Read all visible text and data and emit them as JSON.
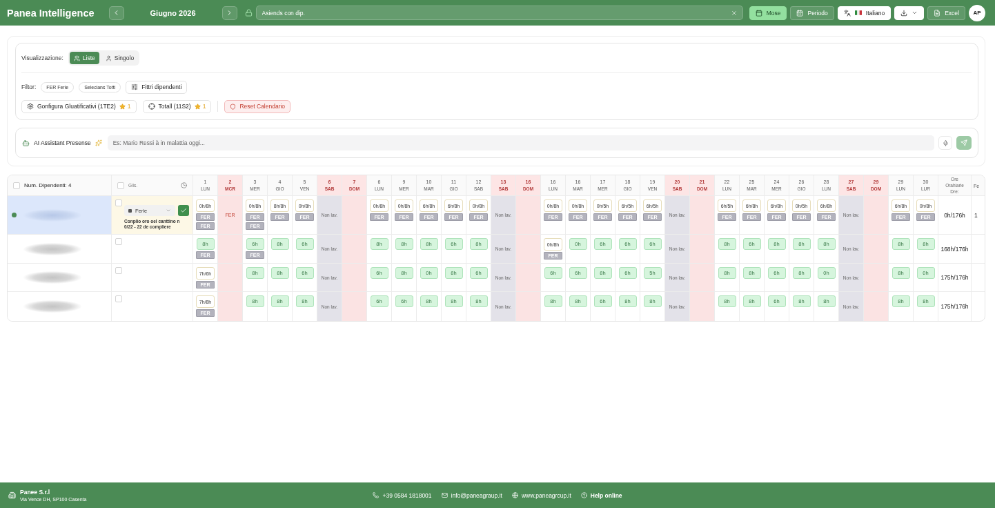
{
  "topbar": {
    "title": "Panea Intelligence",
    "month": "Giugno 2026",
    "search": {
      "value": "Asiends con dip."
    },
    "view_buttons": [
      {
        "label": "Mose",
        "selected": true
      },
      {
        "label": "Periodo",
        "selected": false
      }
    ],
    "language": "Italiano",
    "export": "Excel",
    "avatar": "AP"
  },
  "filters": {
    "view_label": "Visualizzazione:",
    "view_modes": [
      {
        "label": "Liste",
        "selected": true
      },
      {
        "label": "Singolo",
        "selected": false
      }
    ],
    "filter_label": "Filtor:",
    "chips": [
      "FER Ferie",
      "Selecians Totti"
    ],
    "employee_filter": "Fittri dipendenti",
    "actions": [
      {
        "label": "Gonfigura Gluatificativi (1TE2)",
        "count": "1"
      },
      {
        "label": "Totall (11S2)",
        "count": "1"
      }
    ],
    "reset": "Reset Calendario"
  },
  "assistant": {
    "title": "AI Assistant Presense",
    "placeholder": "Es: Mario Ressi à in malattia oggi..."
  },
  "calendar": {
    "name_header": {
      "label": "Num. Dipendenti: 4",
      "checked": false
    },
    "column_2_header": {
      "label": "Giis.",
      "checked": false
    },
    "total_header": "Ore Orahiarie Dre:",
    "column_last_header": "Fe",
    "days": [
      {
        "day": "1",
        "weekday": "LUN",
        "kind": "work"
      },
      {
        "day": "2",
        "weekday": "MCR",
        "kind": "holiday"
      },
      {
        "day": "3",
        "weekday": "MER",
        "kind": "work"
      },
      {
        "day": "4",
        "weekday": "GIO",
        "kind": "work"
      },
      {
        "day": "5",
        "weekday": "VEN",
        "kind": "work"
      },
      {
        "day": "6",
        "weekday": "SAB",
        "kind": "saturday"
      },
      {
        "day": "7",
        "weekday": "DOM",
        "kind": "holiday"
      },
      {
        "day": "6",
        "weekday": "LUN",
        "kind": "work"
      },
      {
        "day": "9",
        "weekday": "MER",
        "kind": "work"
      },
      {
        "day": "10",
        "weekday": "MAR",
        "kind": "work"
      },
      {
        "day": "11",
        "weekday": "GIO",
        "kind": "work"
      },
      {
        "day": "12",
        "weekday": "SAB",
        "kind": "work"
      },
      {
        "day": "13",
        "weekday": "SAB",
        "kind": "saturday"
      },
      {
        "day": "16",
        "weekday": "DOM",
        "kind": "holiday"
      },
      {
        "day": "16",
        "weekday": "LUN",
        "kind": "work"
      },
      {
        "day": "16",
        "weekday": "MAR",
        "kind": "work"
      },
      {
        "day": "17",
        "weekday": "MER",
        "kind": "work"
      },
      {
        "day": "18",
        "weekday": "GIO",
        "kind": "work"
      },
      {
        "day": "19",
        "weekday": "VEN",
        "kind": "work"
      },
      {
        "day": "20",
        "weekday": "SAB",
        "kind": "saturday"
      },
      {
        "day": "21",
        "weekday": "DOM",
        "kind": "holiday"
      },
      {
        "day": "22",
        "weekday": "LUN",
        "kind": "work"
      },
      {
        "day": "25",
        "weekday": "MAR",
        "kind": "work"
      },
      {
        "day": "24",
        "weekday": "MER",
        "kind": "work"
      },
      {
        "day": "26",
        "weekday": "GIO",
        "kind": "work"
      },
      {
        "day": "28",
        "weekday": "LUN",
        "kind": "work"
      },
      {
        "day": "27",
        "weekday": "SAB",
        "kind": "saturday"
      },
      {
        "day": "29",
        "weekday": "DOM",
        "kind": "holiday"
      },
      {
        "day": "29",
        "weekday": "LUN",
        "kind": "work"
      },
      {
        "day": "30",
        "weekday": "LUR",
        "kind": "work"
      }
    ],
    "employees": [
      {
        "selected": true,
        "checked": false,
        "leave": {
          "type": "Ferie",
          "note": "Conplio oro oel canttino n 0/22 - 22 de compliere"
        },
        "total": "0h/176h",
        "column_last": "1",
        "cells": [
          {
            "kind": "pending",
            "value": "0h/8h",
            "tags": [
              "FER",
              "FER"
            ]
          },
          {
            "kind": "absence",
            "value": "FER"
          },
          {
            "kind": "pending",
            "value": "0h/8h",
            "tags": [
              "FER",
              "FER"
            ]
          },
          {
            "kind": "pending",
            "value": "8h/8h",
            "tags": [
              "FER"
            ]
          },
          {
            "kind": "pending",
            "value": "0h/8h",
            "tags": [
              "FER"
            ]
          },
          {
            "kind": "off",
            "value": "Non lav."
          },
          {
            "kind": "empty"
          },
          {
            "kind": "pending",
            "value": "0h/8h",
            "tags": [
              "FER"
            ]
          },
          {
            "kind": "pending",
            "value": "0h/8h",
            "tags": [
              "FER"
            ]
          },
          {
            "kind": "pending",
            "value": "6h/8h",
            "tags": [
              "FER"
            ]
          },
          {
            "kind": "pending",
            "value": "6h/8h",
            "tags": [
              "FER"
            ]
          },
          {
            "kind": "pending",
            "value": "0h/8h",
            "tags": [
              "FER"
            ]
          },
          {
            "kind": "off",
            "value": "Non lav."
          },
          {
            "kind": "empty"
          },
          {
            "kind": "pending",
            "value": "0h/8h",
            "tags": [
              "FER"
            ]
          },
          {
            "kind": "pending",
            "value": "0h/8h",
            "tags": [
              "FER"
            ]
          },
          {
            "kind": "pending",
            "value": "0h/5h",
            "tags": [
              "FER"
            ]
          },
          {
            "kind": "pending",
            "value": "6h/5h",
            "tags": [
              "FER"
            ]
          },
          {
            "kind": "pending",
            "value": "6h/5h",
            "tags": [
              "FER"
            ]
          },
          {
            "kind": "off",
            "value": "Non lav."
          },
          {
            "kind": "empty"
          },
          {
            "kind": "pending",
            "value": "6h/5h",
            "tags": [
              "FER"
            ]
          },
          {
            "kind": "pending",
            "value": "6h/8h",
            "tags": [
              "FER"
            ]
          },
          {
            "kind": "pending",
            "value": "6h/8h",
            "tags": [
              "FER"
            ]
          },
          {
            "kind": "pending",
            "value": "0h/5h",
            "tags": [
              "FER"
            ]
          },
          {
            "kind": "pending",
            "value": "6h/8h",
            "tags": [
              "FER"
            ]
          },
          {
            "kind": "off",
            "value": "Non lav."
          },
          {
            "kind": "empty"
          },
          {
            "kind": "pending",
            "value": "6h/8h",
            "tags": [
              "FER"
            ]
          },
          {
            "kind": "pending",
            "value": "0h/8h",
            "tags": [
              "FER"
            ]
          }
        ]
      },
      {
        "selected": false,
        "checked": false,
        "total": "168h/176h",
        "cells": [
          {
            "kind": "done",
            "value": "8h",
            "tags": [
              "FER"
            ]
          },
          {
            "kind": "empty"
          },
          {
            "kind": "done",
            "value": "6h",
            "tags": [
              "FER"
            ]
          },
          {
            "kind": "done",
            "value": "8h"
          },
          {
            "kind": "done",
            "value": "6h"
          },
          {
            "kind": "off",
            "value": "Non lav."
          },
          {
            "kind": "empty"
          },
          {
            "kind": "done",
            "value": "8h"
          },
          {
            "kind": "done",
            "value": "8h"
          },
          {
            "kind": "done",
            "value": "8h"
          },
          {
            "kind": "done",
            "value": "6h"
          },
          {
            "kind": "done",
            "value": "8h"
          },
          {
            "kind": "off",
            "value": "Non lav."
          },
          {
            "kind": "empty"
          },
          {
            "kind": "pending",
            "value": "0h/8h",
            "tags": [
              "FER"
            ]
          },
          {
            "kind": "done",
            "value": "0h"
          },
          {
            "kind": "done",
            "value": "6h"
          },
          {
            "kind": "done",
            "value": "6h"
          },
          {
            "kind": "done",
            "value": "6h"
          },
          {
            "kind": "off",
            "value": "Non lav."
          },
          {
            "kind": "empty"
          },
          {
            "kind": "done",
            "value": "8h"
          },
          {
            "kind": "done",
            "value": "6h"
          },
          {
            "kind": "done",
            "value": "8h"
          },
          {
            "kind": "done",
            "value": "8h"
          },
          {
            "kind": "done",
            "value": "8h"
          },
          {
            "kind": "off",
            "value": "Non lav."
          },
          {
            "kind": "empty"
          },
          {
            "kind": "done",
            "value": "8h"
          },
          {
            "kind": "done",
            "value": "8h"
          }
        ]
      },
      {
        "selected": false,
        "checked": false,
        "total": "175h/176h",
        "cells": [
          {
            "kind": "pending",
            "value": "7h/6h",
            "tags": [
              "FER"
            ]
          },
          {
            "kind": "empty"
          },
          {
            "kind": "done",
            "value": "8h"
          },
          {
            "kind": "done",
            "value": "8h"
          },
          {
            "kind": "done",
            "value": "6h"
          },
          {
            "kind": "off",
            "value": "Non lav."
          },
          {
            "kind": "empty"
          },
          {
            "kind": "done",
            "value": "6h"
          },
          {
            "kind": "done",
            "value": "8h"
          },
          {
            "kind": "done",
            "value": "0h"
          },
          {
            "kind": "done",
            "value": "8h"
          },
          {
            "kind": "done",
            "value": "6h"
          },
          {
            "kind": "off",
            "value": "Non lav."
          },
          {
            "kind": "empty"
          },
          {
            "kind": "done",
            "value": "6h"
          },
          {
            "kind": "done",
            "value": "6h"
          },
          {
            "kind": "done",
            "value": "8h"
          },
          {
            "kind": "done",
            "value": "6h"
          },
          {
            "kind": "done",
            "value": "5h"
          },
          {
            "kind": "off",
            "value": "Non lav."
          },
          {
            "kind": "empty"
          },
          {
            "kind": "done",
            "value": "8h"
          },
          {
            "kind": "done",
            "value": "8h"
          },
          {
            "kind": "done",
            "value": "6h"
          },
          {
            "kind": "done",
            "value": "8h"
          },
          {
            "kind": "done",
            "value": "0h"
          },
          {
            "kind": "off",
            "value": "Non lav."
          },
          {
            "kind": "empty"
          },
          {
            "kind": "done",
            "value": "8h"
          },
          {
            "kind": "done",
            "value": "0h"
          }
        ]
      },
      {
        "selected": false,
        "checked": false,
        "total": "175h/176h",
        "cells": [
          {
            "kind": "pending",
            "value": "7h/8h",
            "tags": [
              "FER"
            ]
          },
          {
            "kind": "empty"
          },
          {
            "kind": "done",
            "value": "8h"
          },
          {
            "kind": "done",
            "value": "8h"
          },
          {
            "kind": "done",
            "value": "8h"
          },
          {
            "kind": "off",
            "value": "Non lav."
          },
          {
            "kind": "empty"
          },
          {
            "kind": "done",
            "value": "6h"
          },
          {
            "kind": "done",
            "value": "6h"
          },
          {
            "kind": "done",
            "value": "8h"
          },
          {
            "kind": "done",
            "value": "8h"
          },
          {
            "kind": "done",
            "value": "8h"
          },
          {
            "kind": "off",
            "value": "Non lav."
          },
          {
            "kind": "empty"
          },
          {
            "kind": "done",
            "value": "8h"
          },
          {
            "kind": "done",
            "value": "8h"
          },
          {
            "kind": "done",
            "value": "6h"
          },
          {
            "kind": "done",
            "value": "8h"
          },
          {
            "kind": "done",
            "value": "8h"
          },
          {
            "kind": "off",
            "value": "Non lav."
          },
          {
            "kind": "empty"
          },
          {
            "kind": "done",
            "value": "8h"
          },
          {
            "kind": "done",
            "value": "8h"
          },
          {
            "kind": "done",
            "value": "6h"
          },
          {
            "kind": "done",
            "value": "8h"
          },
          {
            "kind": "done",
            "value": "8h"
          },
          {
            "kind": "off",
            "value": "Non lav."
          },
          {
            "kind": "empty"
          },
          {
            "kind": "done",
            "value": "8h"
          },
          {
            "kind": "done",
            "value": "8h"
          }
        ]
      }
    ]
  },
  "footer": {
    "company": "Panee S.r.l",
    "address": "Via Vence DH, SP100 Casenta",
    "contacts": [
      "+39 0584 1818001",
      "info@paneagraup.it",
      "www.paneagrcup.it"
    ],
    "help": "Help online"
  }
}
